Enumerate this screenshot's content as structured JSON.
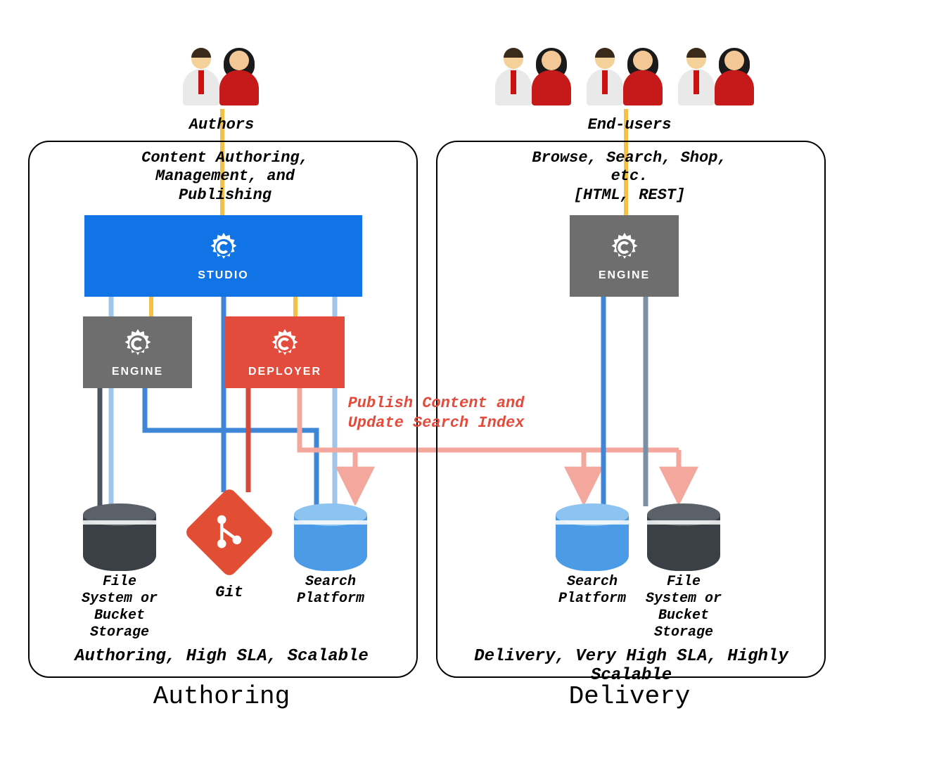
{
  "actors": {
    "authors_label": "Authors",
    "endusers_label": "End-users"
  },
  "authoring": {
    "title": "Authoring",
    "headline": "Content Authoring,\nManagement, and\nPublishing",
    "nodes": {
      "studio": "STUDIO",
      "engine": "ENGINE",
      "deployer": "DEPLOYER"
    },
    "stores": {
      "file": "File\nSystem or\nBucket\nStorage",
      "git": "Git",
      "search": "Search\nPlatform"
    },
    "caption": "Authoring, High SLA, Scalable"
  },
  "delivery": {
    "title": "Delivery",
    "headline": "Browse, Search, Shop,\netc.\n[HTML, REST]",
    "nodes": {
      "engine": "ENGINE"
    },
    "stores": {
      "search": "Search\nPlatform",
      "file": "File\nSystem or\nBucket\nStorage"
    },
    "caption": "Delivery, Very High SLA, Highly Scalable"
  },
  "publish_label": "Publish Content\nand Update\nSearch Index",
  "icon_names": {
    "users": "users-icon",
    "gear": "gear-c-icon",
    "cylinder": "database-icon",
    "git": "git-icon"
  },
  "colors": {
    "studio": "#1073e6",
    "engine": "#6e6e6e",
    "deployer": "#e34c3c",
    "git": "#e24e33",
    "cyl_gray": "#3a4045",
    "cyl_blue": "#4b9be6",
    "publish_text": "#e34c3c"
  }
}
